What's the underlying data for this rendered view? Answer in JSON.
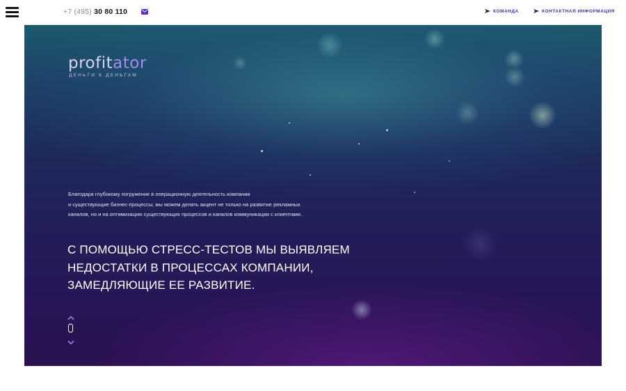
{
  "header": {
    "phone_prefix": "+7 (495)",
    "phone_number": "30 80 110",
    "mail_icon": "mail-icon",
    "nav": [
      {
        "label": "КОМАНДА",
        "icon": "chevron-icon"
      },
      {
        "label": "КОНТАКТНАЯ ИНФОРМАЦИЯ",
        "icon": "chevron-icon"
      }
    ]
  },
  "menu": {
    "icon": "hamburger-menu-icon"
  },
  "hero": {
    "logo": {
      "wordmark_part1": "profit",
      "wordmark_part2": "ator",
      "tagline": "ДЕНЬГИ К ДЕНЬГАМ"
    },
    "intro_lines": [
      "Благодаря глубокому погружение в операционную деятельность компании",
      "и существующие бизнес-процессы, мы можем делать акцент не только на развитие рекламных",
      "каналов, но и на оптимизацию существующих процессов и каналов коммуникации с клиентами."
    ],
    "headline_lines": [
      "С ПОМОЩЬЮ СТРЕСС-ТЕСТОВ МЫ ВЫЯВЛЯЕМ",
      "НЕДОСТАТКИ В ПРОЦЕССАХ КОМПАНИИ,",
      "ЗАМЕДЛЯЮЩИЕ ЕЕ РАЗВИТИЕ."
    ],
    "scroll": {
      "up_icon": "chevron-up-icon",
      "mouse_icon": "mouse-icon",
      "down_icon": "chevron-down-icon"
    }
  },
  "colors": {
    "accent": "#4a2ea8",
    "logo_accent": "#a58ce8",
    "scroll_accent": "#a07de6"
  }
}
